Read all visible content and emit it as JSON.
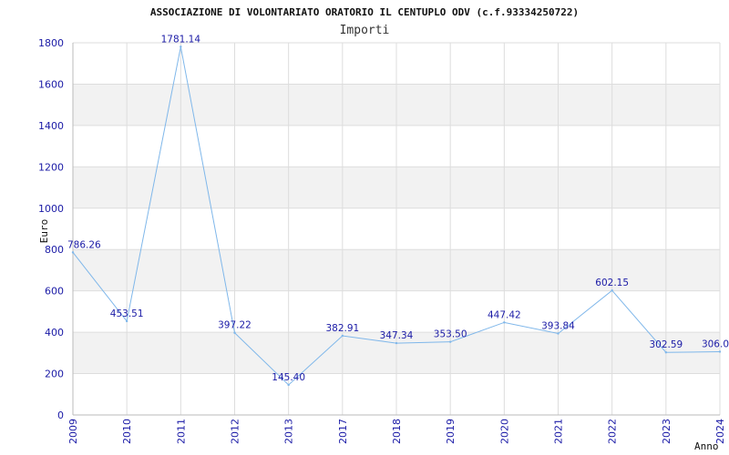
{
  "chart_data": {
    "type": "line",
    "title": "ASSOCIAZIONE DI VOLONTARIATO ORATORIO IL CENTUPLO ODV (c.f.93334250722)",
    "subtitle": "Importi",
    "xlabel": "Anno",
    "ylabel": "Euro",
    "ylim": [
      0,
      1800
    ],
    "yticks": [
      0,
      200,
      400,
      600,
      800,
      1000,
      1200,
      1400,
      1600,
      1800
    ],
    "categories": [
      "2009",
      "2010",
      "2011",
      "2012",
      "2013",
      "2017",
      "2018",
      "2019",
      "2020",
      "2021",
      "2022",
      "2023",
      "2024"
    ],
    "series": [
      {
        "values": [
          786.26,
          453.51,
          1781.14,
          397.22,
          145.4,
          382.91,
          347.34,
          353.5,
          447.42,
          393.84,
          602.15,
          302.59,
          306.0
        ],
        "data_labels": [
          "786.26",
          "453.51",
          "1781.14",
          "397.22",
          "145.40",
          "382.91",
          "347.34",
          "353.50",
          "447.42",
          "393.84",
          "602.15",
          "302.59",
          "306.0"
        ]
      }
    ],
    "grid": true,
    "colors": {
      "line": "#7fb7ea",
      "axis_text": "#1a1aa6",
      "band": "#f2f2f2",
      "grid": "#dddddd",
      "data_label": "#1a1aa6"
    }
  }
}
